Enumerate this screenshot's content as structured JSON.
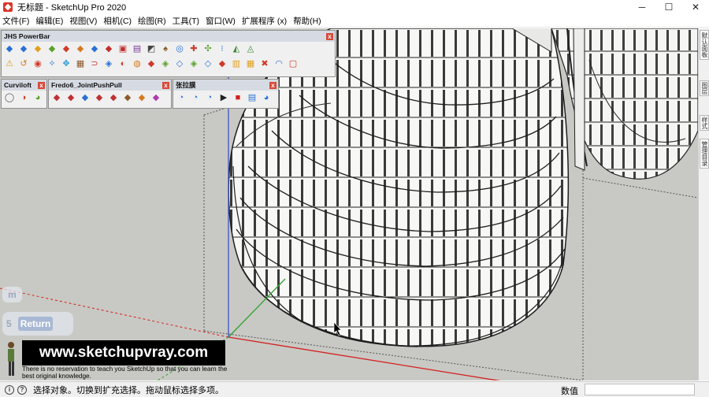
{
  "window": {
    "title": "无标题 - SketchUp Pro 2020",
    "minimize": "─",
    "maximize": "☐",
    "close": "✕"
  },
  "menu": [
    "文件(F)",
    "编辑(E)",
    "视图(V)",
    "相机(C)",
    "绘图(R)",
    "工具(T)",
    "窗口(W)",
    "扩展程序 (x)",
    "帮助(H)"
  ],
  "toolbars": {
    "jhs": {
      "title": "JHS PowerBar",
      "row1": [
        "◆",
        "◆",
        "◆",
        "◆",
        "◆",
        "◆",
        "◆",
        "◆",
        "▣",
        "▤",
        "◩",
        "♠",
        "◎",
        "✚",
        "✣",
        "⁝",
        "◭",
        "◬"
      ],
      "row2": [
        "⚠",
        "↺",
        "◉",
        "✧",
        "✥",
        "▦",
        "⊃",
        "◈",
        "◐",
        "◍",
        "◆",
        "◈",
        "◇",
        "◈",
        "◇",
        "◆",
        "▥",
        "▦",
        "✖",
        "◠",
        "▢"
      ]
    },
    "curviloft": {
      "title": "Curviloft",
      "buttons": [
        "◯",
        "◑",
        "◕"
      ]
    },
    "fredo": {
      "title": "Fredo6_JointPushPull",
      "buttons": [
        "◆",
        "◆",
        "◆",
        "◆",
        "◆",
        "◆",
        "◆",
        "◆"
      ]
    },
    "zhanglamo": {
      "title": "张拉膜",
      "buttons": [
        "◔",
        "◔",
        "◔",
        "▶",
        "■",
        "▤",
        "◕"
      ]
    }
  },
  "dock_tabs": [
    "默认面板",
    "图层",
    "样式",
    "管理目录"
  ],
  "overlay": {
    "key_m": "m",
    "key_5": "5",
    "key_return": "Return"
  },
  "watermark": {
    "url": "www.sketchupvray.com",
    "sub": "There is no reservation to teach you SketchUp so that you can learn the best original knowledge."
  },
  "status": {
    "text": "选择对象。切换到扩充选择。拖动鼠标选择多项。",
    "measurements_label": "数值",
    "measurements_value": ""
  },
  "colors": {
    "viewport_bg": "#c8c9c4",
    "axis_red": "#d41f1f",
    "axis_green": "#2fa02f",
    "axis_blue": "#3b53c9"
  }
}
